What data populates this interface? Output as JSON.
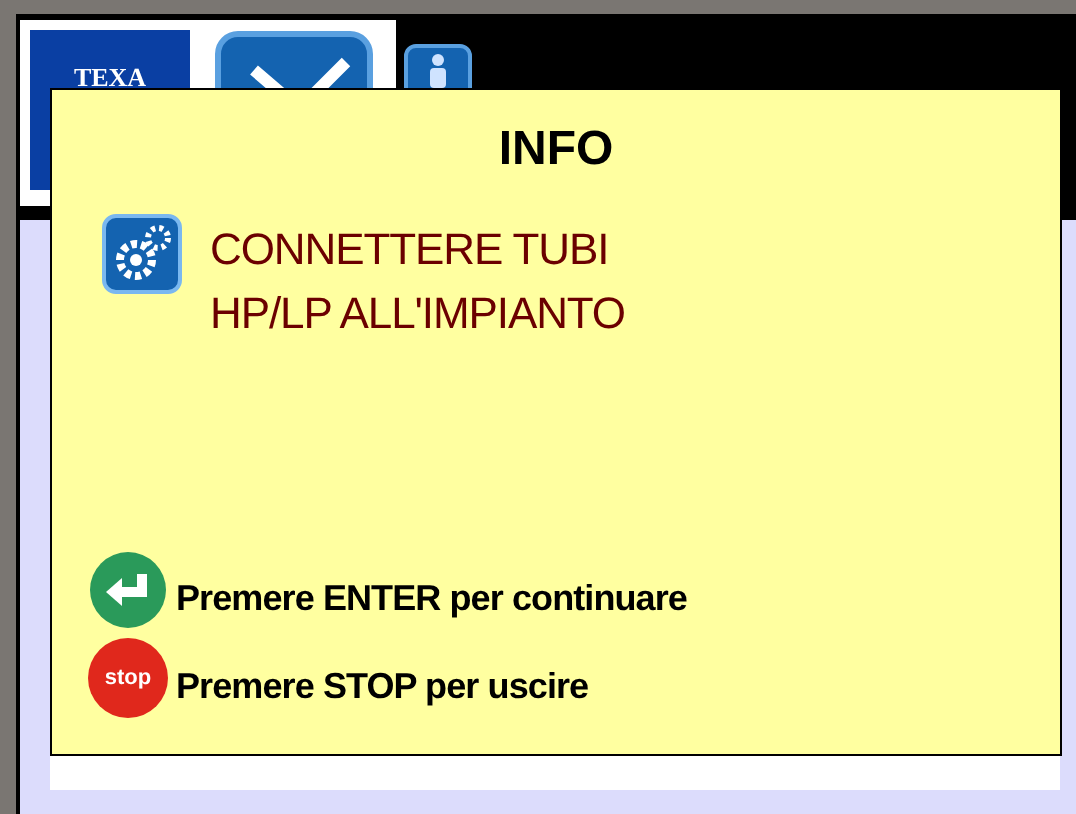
{
  "header": {
    "logo_text": "TEXA"
  },
  "dialog": {
    "title": "INFO",
    "message_lines": [
      "CONNETTERE TUBI",
      "HP/LP ALL'IMPIANTO"
    ],
    "actions": [
      {
        "kind": "enter",
        "label": "Premere ENTER per continuare"
      },
      {
        "kind": "stop",
        "icon_text": "stop",
        "label": "Premere STOP per uscire"
      }
    ]
  }
}
